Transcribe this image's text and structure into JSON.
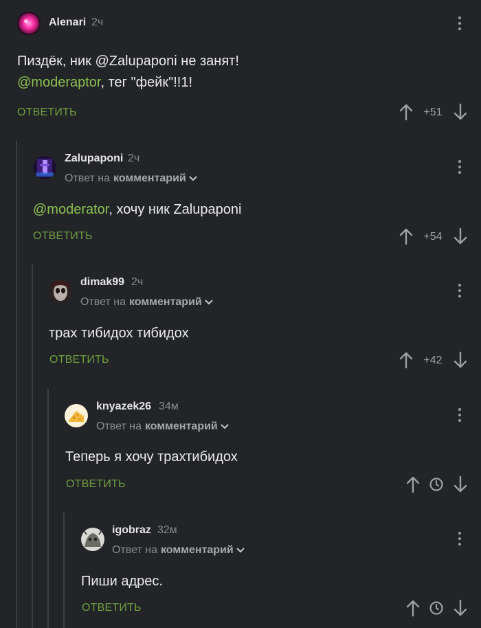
{
  "comments": [
    {
      "username": "Alenari",
      "time": "2ч",
      "avatar": "pink-glow-avatar",
      "body_line1": "Пиздёк, ник @Zalupaponi не занят!",
      "body_line2_mention": "@moderaptor",
      "body_line2_rest": ", тег \"фейк\"!!1!",
      "reply_label": "ОТВЕТИТЬ",
      "score": "+51"
    },
    {
      "username": "Zalupaponi",
      "time": "2ч",
      "avatar": "purple-figure-avatar",
      "reply_prefix": "Ответ на",
      "reply_target": "комментарий",
      "body_mention": "@moderator",
      "body_rest": ", хочу ник Zalupaponi",
      "reply_label": "ОТВЕТИТЬ",
      "score": "+54"
    },
    {
      "username": "dimak99",
      "time": "2ч",
      "avatar": "dark-face-avatar",
      "reply_prefix": "Ответ на",
      "reply_target": "комментарий",
      "body": "трах тибидох тибидох",
      "reply_label": "ОТВЕТИТЬ",
      "score": "+42"
    },
    {
      "username": "knyazek26",
      "time": "34м",
      "avatar": "cheese-avatar",
      "reply_prefix": "Ответ на",
      "reply_target": "комментарий",
      "body": "Теперь я хочу трахтибидох",
      "reply_label": "ОТВЕТИТЬ",
      "score_state": "clock-icon"
    },
    {
      "username": "igobraz",
      "time": "32м",
      "avatar": "grey-creature-avatar",
      "reply_prefix": "Ответ на",
      "reply_target": "комментарий",
      "body": "Пиши адрес.",
      "reply_label": "ОТВЕТИТЬ",
      "score_state": "clock-icon"
    }
  ],
  "colors": {
    "background": "#222427",
    "accent_green": "#6e9f3f",
    "mention_green": "#8cc152",
    "muted": "#8a8d91"
  }
}
